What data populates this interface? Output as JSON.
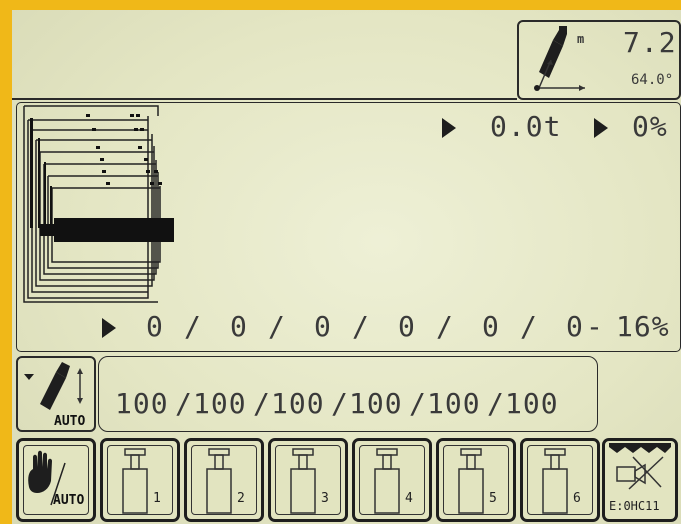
{
  "boom": {
    "icon": "crane-boom-angle-icon",
    "unit_label": "m",
    "length_value": "7.2",
    "angle_value": "64.0°"
  },
  "load": {
    "load_value": "0.0t",
    "percent_value": "0%"
  },
  "sections": {
    "values": [
      "0",
      "0",
      "0",
      "0",
      "0",
      "0"
    ],
    "separators": [
      "/",
      "/",
      "/",
      "/",
      "/"
    ],
    "dash": "-",
    "total_percent": "16%"
  },
  "telescoping": {
    "icon": "boom-extend-auto-icon",
    "mode_label": "AUTO",
    "values": [
      "100",
      "100",
      "100",
      "100",
      "100",
      "100"
    ],
    "separators": [
      "/",
      "/",
      "/",
      "/",
      "/"
    ]
  },
  "softkeys": {
    "manual_auto": {
      "icon": "hand-auto-icon",
      "label": "AUTO"
    },
    "cylinders": [
      {
        "icon": "cylinder-icon",
        "label": "1"
      },
      {
        "icon": "cylinder-icon",
        "label": "2"
      },
      {
        "icon": "cylinder-icon",
        "label": "3"
      },
      {
        "icon": "cylinder-icon",
        "label": "4"
      },
      {
        "icon": "cylinder-icon",
        "label": "5"
      },
      {
        "icon": "cylinder-icon",
        "label": "6"
      }
    ],
    "error": {
      "icon": "error-x-icon",
      "code": "E:0HC11"
    }
  },
  "colors": {
    "lcd": "#e4e6c4",
    "ink": "#222222",
    "bezel": "#f0b818"
  }
}
